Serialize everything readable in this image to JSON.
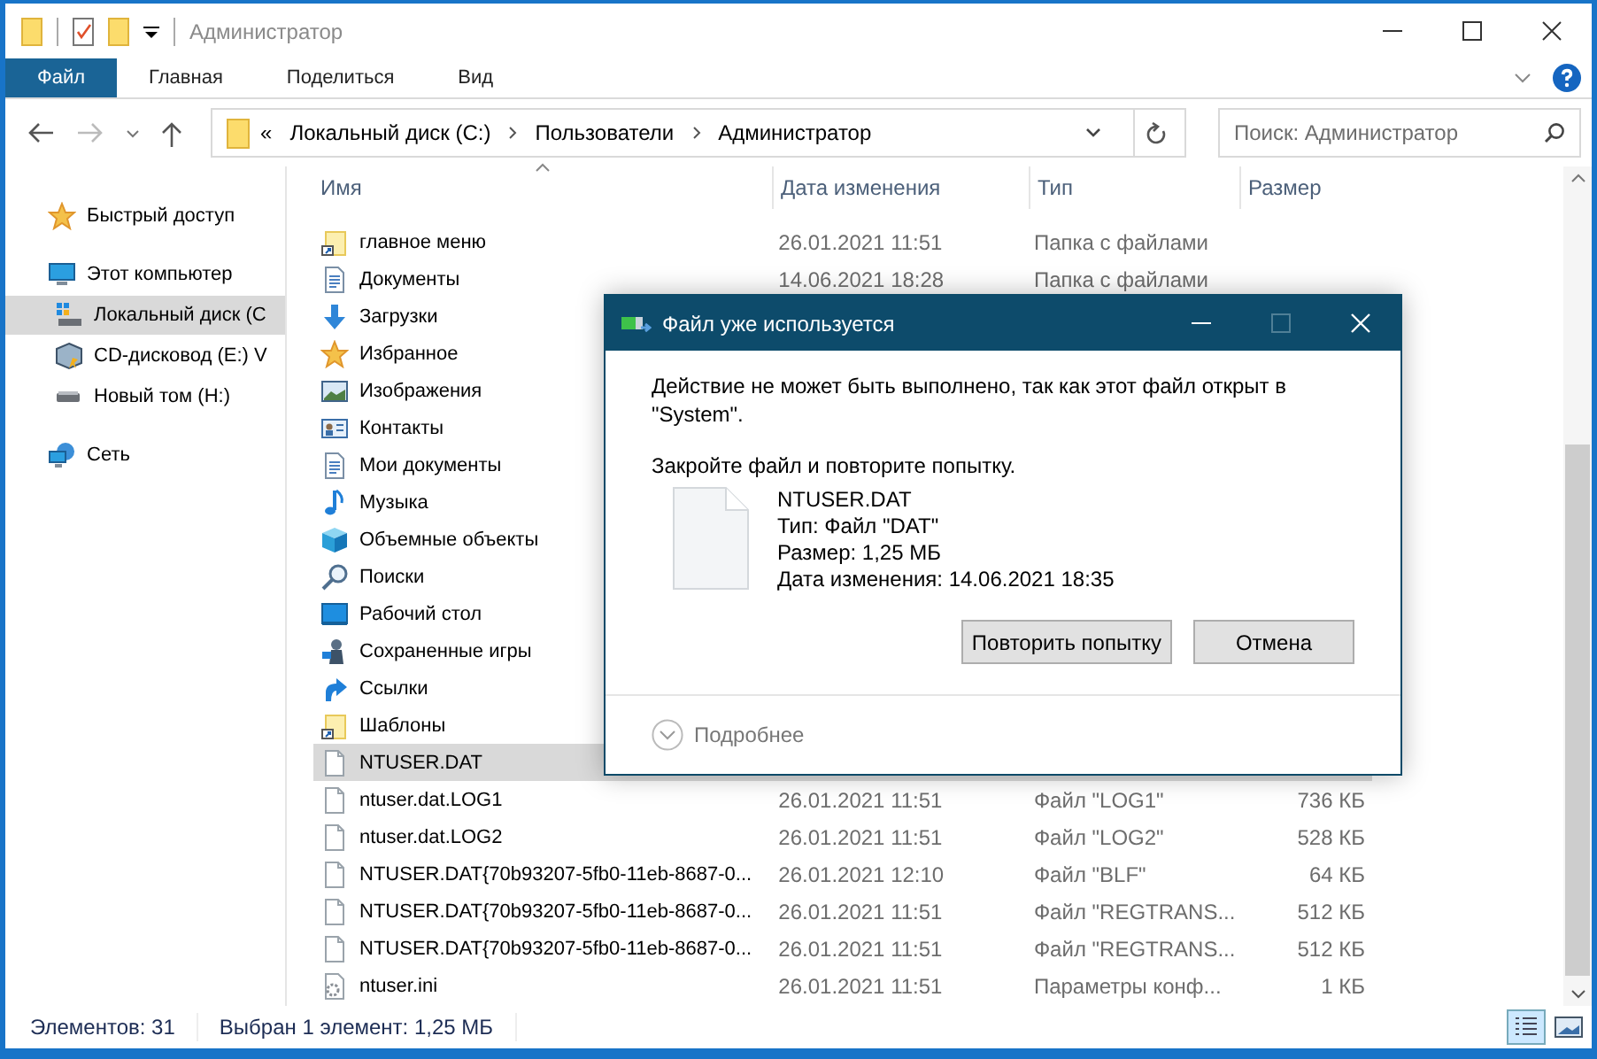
{
  "window": {
    "title": "Администратор"
  },
  "ribbon_tabs": [
    {
      "label": "Файл",
      "selected": true
    },
    {
      "label": "Главная",
      "selected": false
    },
    {
      "label": "Поделиться",
      "selected": false
    },
    {
      "label": "Вид",
      "selected": false
    }
  ],
  "address": {
    "overflow": "«",
    "crumbs": [
      "Локальный диск (C:)",
      "Пользователи",
      "Администратор"
    ]
  },
  "search": {
    "placeholder": "Поиск: Администратор"
  },
  "sidebar": {
    "items": [
      {
        "label": "Быстрый доступ",
        "kind": "star",
        "selected": false
      },
      {
        "label": "Этот компьютер",
        "kind": "computer",
        "selected": false,
        "children": [
          {
            "label": "Локальный диск (C",
            "kind": "disk",
            "selected": true
          },
          {
            "label": "CD-дисковод (E:) V",
            "kind": "cd",
            "selected": false
          },
          {
            "label": "Новый том (H:)",
            "kind": "drive",
            "selected": false
          }
        ]
      },
      {
        "label": "Сеть",
        "kind": "network",
        "selected": false
      }
    ]
  },
  "table": {
    "columns": [
      "Имя",
      "Дата изменения",
      "Тип",
      "Размер"
    ],
    "rows": [
      {
        "name": "главное меню",
        "date": "26.01.2021 11:51",
        "type": "Папка с файлами",
        "kind": "folder-link",
        "selected": false
      },
      {
        "name": "Документы",
        "date": "14.06.2021 18:28",
        "type": "Папка с файлами",
        "kind": "documents",
        "selected": false
      },
      {
        "name": "Загрузки",
        "kind": "download",
        "selected": false
      },
      {
        "name": "Избранное",
        "kind": "star",
        "selected": false
      },
      {
        "name": "Изображения",
        "kind": "pictures",
        "selected": false
      },
      {
        "name": "Контакты",
        "kind": "contacts",
        "selected": false
      },
      {
        "name": "Мои документы",
        "kind": "documents-link",
        "selected": false
      },
      {
        "name": "Музыка",
        "kind": "music",
        "selected": false
      },
      {
        "name": "Объемные объекты",
        "kind": "cube",
        "selected": false
      },
      {
        "name": "Поиски",
        "kind": "search",
        "selected": false
      },
      {
        "name": "Рабочий стол",
        "kind": "desktop",
        "selected": false
      },
      {
        "name": "Сохраненные игры",
        "kind": "games",
        "selected": false
      },
      {
        "name": "Ссылки",
        "kind": "links",
        "selected": false
      },
      {
        "name": "Шаблоны",
        "kind": "folder-link",
        "selected": false
      },
      {
        "name": "NTUSER.DAT",
        "kind": "file",
        "selected": true
      },
      {
        "name": "ntuser.dat.LOG1",
        "date": "26.01.2021 11:51",
        "type": "Файл \"LOG1\"",
        "size": "736 КБ",
        "kind": "file",
        "selected": false
      },
      {
        "name": "ntuser.dat.LOG2",
        "date": "26.01.2021 11:51",
        "type": "Файл \"LOG2\"",
        "size": "528 КБ",
        "kind": "file",
        "selected": false
      },
      {
        "name": "NTUSER.DAT{70b93207-5fb0-11eb-8687-0...",
        "date": "26.01.2021 12:10",
        "type": "Файл \"BLF\"",
        "size": "64 КБ",
        "kind": "file",
        "selected": false
      },
      {
        "name": "NTUSER.DAT{70b93207-5fb0-11eb-8687-0...",
        "date": "26.01.2021 11:51",
        "type": "Файл \"REGTRANS...",
        "size": "512 КБ",
        "kind": "file",
        "selected": false
      },
      {
        "name": "NTUSER.DAT{70b93207-5fb0-11eb-8687-0...",
        "date": "26.01.2021 11:51",
        "type": "Файл \"REGTRANS...",
        "size": "512 КБ",
        "kind": "file",
        "selected": false
      },
      {
        "name": "ntuser.ini",
        "date": "26.01.2021 11:51",
        "type": "Параметры конф...",
        "size": "1 КБ",
        "kind": "settings-file",
        "selected": false
      }
    ]
  },
  "status_bar": {
    "items_count": "Элементов: 31",
    "selection": "Выбран 1 элемент: 1,25 МБ"
  },
  "dialog": {
    "title": "Файл уже используется",
    "message": "Действие не может быть выполнено, так как этот файл открыт в \"System\".",
    "hint": "Закройте файл и повторите попытку.",
    "file": {
      "name": "NTUSER.DAT",
      "type": "Тип: Файл \"DAT\"",
      "size": "Размер: 1,25 МБ",
      "modified": "Дата изменения: 14.06.2021 18:35"
    },
    "buttons": [
      "Повторить попытку",
      "Отмена"
    ],
    "details": "Подробнее"
  }
}
